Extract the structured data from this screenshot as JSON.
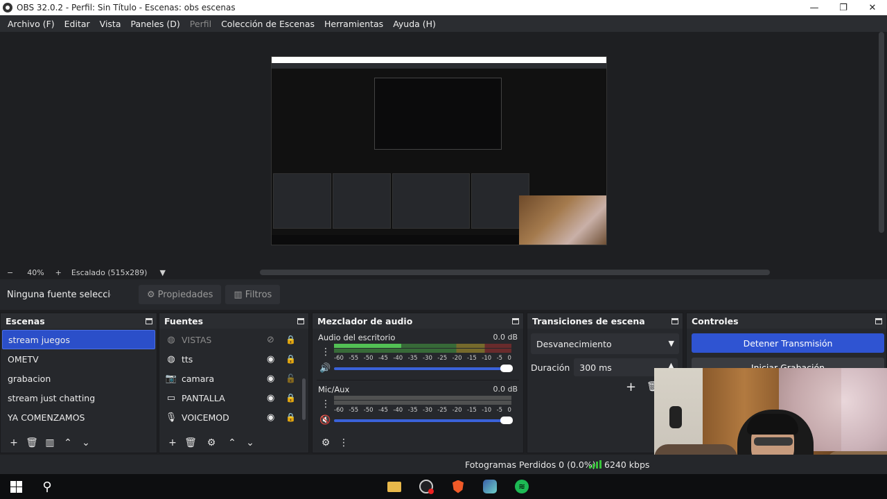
{
  "window": {
    "title": "OBS 32.0.2 - Perfil: Sin Título - Escenas: obs escenas",
    "minimize": "—",
    "restore": "❐",
    "close": "✕"
  },
  "menu": {
    "items": [
      {
        "label": "Archivo (F)",
        "disabled": false
      },
      {
        "label": "Editar",
        "disabled": false
      },
      {
        "label": "Vista",
        "disabled": false
      },
      {
        "label": "Paneles (D)",
        "disabled": false
      },
      {
        "label": "Perfil",
        "disabled": true
      },
      {
        "label": "Colección de Escenas",
        "disabled": false
      },
      {
        "label": "Herramientas",
        "disabled": false
      },
      {
        "label": "Ayuda (H)",
        "disabled": false
      }
    ]
  },
  "zoom": {
    "minus": "−",
    "percent": "40%",
    "plus": "+",
    "scaling": "Escalado (515x289)",
    "caret": "▼"
  },
  "source_toolbar": {
    "no_selection": "Ninguna fuente seleccionad",
    "properties": "Propiedades",
    "filters": "Filtros"
  },
  "scenes": {
    "title": "Escenas",
    "items": [
      "stream juegos",
      "OMETV",
      "grabacion",
      "stream just chatting",
      "YA COMENZAMOS"
    ],
    "selected_index": 0
  },
  "sources": {
    "title": "Fuentes",
    "items": [
      {
        "name": "VISTAS",
        "icon": "globe-icon",
        "visible": false,
        "locked": true
      },
      {
        "name": "tts",
        "icon": "globe-icon",
        "visible": true,
        "locked": true
      },
      {
        "name": "camara",
        "icon": "camera-icon",
        "visible": true,
        "locked": false
      },
      {
        "name": "PANTALLA",
        "icon": "monitor-icon",
        "visible": true,
        "locked": true
      },
      {
        "name": "VOICEMOD",
        "icon": "microphone-icon",
        "visible": true,
        "locked": true
      }
    ]
  },
  "mixer": {
    "title": "Mezclador de audio",
    "ticks": [
      "-60",
      "-55",
      "-50",
      "-45",
      "-40",
      "-35",
      "-30",
      "-25",
      "-20",
      "-15",
      "-10",
      "-5",
      "0"
    ],
    "channels": [
      {
        "name": "Audio del escritorio",
        "db": "0.0 dB",
        "muted": false,
        "level": 0.38,
        "volume": 1.0
      },
      {
        "name": "Mic/Aux",
        "db": "0.0 dB",
        "muted": true,
        "level": 0.0,
        "volume": 1.0
      }
    ]
  },
  "transitions": {
    "title": "Transiciones de escena",
    "selected": "Desvanecimiento",
    "duration_label": "Duración",
    "duration_value": "300 ms"
  },
  "controls": {
    "title": "Controles",
    "stop_stream": "Detener Transmisión",
    "start_recording": "Iniciar Grabación"
  },
  "status": {
    "frames_dropped": "Fotogramas Perdidos 0 (0.0%)",
    "bitrate": "6240 kbps"
  },
  "colors": {
    "accent": "#2f54d2",
    "selected": "#2b4fc9",
    "meter_green": "#59d65b",
    "dock_bg": "#26282c"
  }
}
